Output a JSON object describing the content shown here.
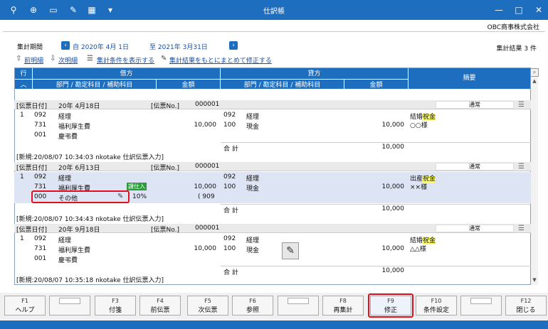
{
  "titlebar": {
    "title": "仕訳帳",
    "icons": [
      "search-plus-icon",
      "zoom-icon",
      "printer-icon",
      "tools-icon",
      "excel-icon",
      "dropdown-icon"
    ],
    "minimize": "—",
    "maximize": "□",
    "close": "✕"
  },
  "company": "OBC商事株式会社",
  "period": {
    "label": "集計期間",
    "from": "自 2020年  4月 1日",
    "to": "至 2021年  3月31日",
    "prev_arrow": "‹",
    "next_arrow": "›"
  },
  "links": {
    "prev": "前明細",
    "next": "次明細",
    "show_conditions": "集計条件を表示する",
    "bulk_fix": "集計結果をもとにまとめて修正する"
  },
  "count": "集計結果 3 件",
  "grid_header": {
    "row": "行",
    "debit": "借方",
    "credit": "貸方",
    "summary": "摘要",
    "dept_sub": "部門 / 勘定科目 / 補助科目",
    "amount": "金額",
    "sort_arrow": "︿"
  },
  "vouchers": [
    {
      "date_label": "[伝票日付]",
      "date": "20年  4月18日",
      "no_label": "[伝票No.]",
      "no": "000001",
      "type": "通常",
      "row": "1",
      "debit": {
        "dept": "092",
        "acct_code": "731",
        "sub_code": "001",
        "dept_name": "経理",
        "acct_name": "福利厚生費",
        "sub_name": "慶弔費",
        "amount": "10,000"
      },
      "credit": {
        "dept": "092",
        "acct_code": "100",
        "dept_name": "経理",
        "acct_name": "現金",
        "amount": "10,000"
      },
      "summary_pre": "結婚",
      "summary_hl": "祝金",
      "summary_line2": "○○様",
      "total_label": "合 計",
      "total": "10,000",
      "footer": "[新規:20/08/07 10:34:03  nkotake  仕訳伝票入力]"
    },
    {
      "date_label": "[伝票日付]",
      "date": "20年  6月13日",
      "no_label": "[伝票No.]",
      "no": "000001",
      "type": "通常",
      "row": "1",
      "debit": {
        "dept": "092",
        "acct_code": "731",
        "sub_code": "000",
        "dept_name": "経理",
        "acct_name": "福利厚生費",
        "sub_name": "その他",
        "amount": "10,000",
        "tax_rate": "10%",
        "tax_amount": "( 909",
        "tag": "課仕入"
      },
      "credit": {
        "dept": "092",
        "acct_code": "100",
        "dept_name": "経理",
        "acct_name": "現金",
        "amount": "10,000"
      },
      "summary_pre": "出産",
      "summary_hl": "祝金",
      "summary_line2": "××様",
      "total_label": "合 計",
      "total": "10,000",
      "footer": "[新規:20/08/07 10:34:43  nkotake  仕訳伝票入力]"
    },
    {
      "date_label": "[伝票日付]",
      "date": "20年  9月18日",
      "no_label": "[伝票No.]",
      "no": "000001",
      "type": "通常",
      "row": "1",
      "debit": {
        "dept": "092",
        "acct_code": "731",
        "sub_code": "001",
        "dept_name": "経理",
        "acct_name": "福利厚生費",
        "sub_name": "慶弔費",
        "amount": "10,000"
      },
      "credit": {
        "dept": "092",
        "acct_code": "100",
        "dept_name": "経理",
        "acct_name": "現金",
        "amount": "10,000"
      },
      "summary_pre": "結婚",
      "summary_hl": "祝金",
      "summary_line2": "△△様",
      "total_label": "合 計",
      "total": "10,000",
      "footer": "[新規:20/08/07 10:35:18  nkotake  仕訳伝票入力]"
    }
  ],
  "fkeys": [
    {
      "key": "F1",
      "label": "ヘルプ"
    },
    {
      "key": "",
      "label": ""
    },
    {
      "key": "F3",
      "label": "付箋"
    },
    {
      "key": "F4",
      "label": "前伝票"
    },
    {
      "key": "F5",
      "label": "次伝票"
    },
    {
      "key": "F6",
      "label": "参照"
    },
    {
      "key": "",
      "label": ""
    },
    {
      "key": "F8",
      "label": "再集計"
    },
    {
      "key": "F9",
      "label": "修正"
    },
    {
      "key": "F10",
      "label": "条件設定"
    },
    {
      "key": "",
      "label": ""
    },
    {
      "key": "F12",
      "label": "閉じる"
    }
  ],
  "colors": {
    "accent": "#1e6ec0",
    "highlight": "#ffff66",
    "selected_row": "#dde4f4",
    "callout": "#e0101e",
    "tag": "#2a9c3a"
  }
}
